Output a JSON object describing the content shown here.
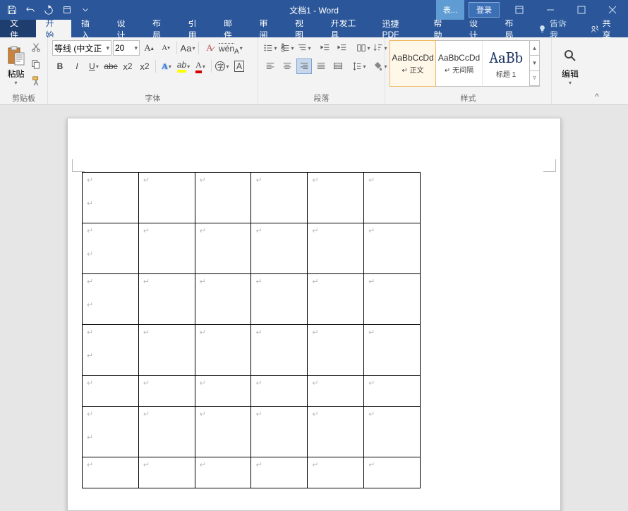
{
  "titlebar": {
    "title": "文档1 - Word",
    "context_tab": "表...",
    "login": "登录"
  },
  "tabs": {
    "file": "文件",
    "home": "开始",
    "insert": "插入",
    "design": "设计",
    "layout": "布局",
    "references": "引用",
    "mailings": "邮件",
    "review": "审阅",
    "view": "视图",
    "developer": "开发工具",
    "pdf": "迅捷PDF",
    "help": "帮助",
    "tool_design": "设计",
    "tool_layout": "布局",
    "tell_me": "告诉我",
    "share": "共享"
  },
  "groups": {
    "clipboard": "剪贴板",
    "font": "字体",
    "paragraph": "段落",
    "styles": "样式",
    "editing": "编辑"
  },
  "clipboard": {
    "paste": "粘贴"
  },
  "font": {
    "name": "等线 (中文正",
    "size": "20"
  },
  "styles": {
    "items": [
      {
        "preview": "AaBbCcDd",
        "name": "↵ 正文"
      },
      {
        "preview": "AaBbCcDd",
        "name": "↵ 无间隔"
      },
      {
        "preview": "AaBb",
        "name": "标题 1"
      }
    ]
  },
  "editing": {
    "label": "编辑"
  }
}
